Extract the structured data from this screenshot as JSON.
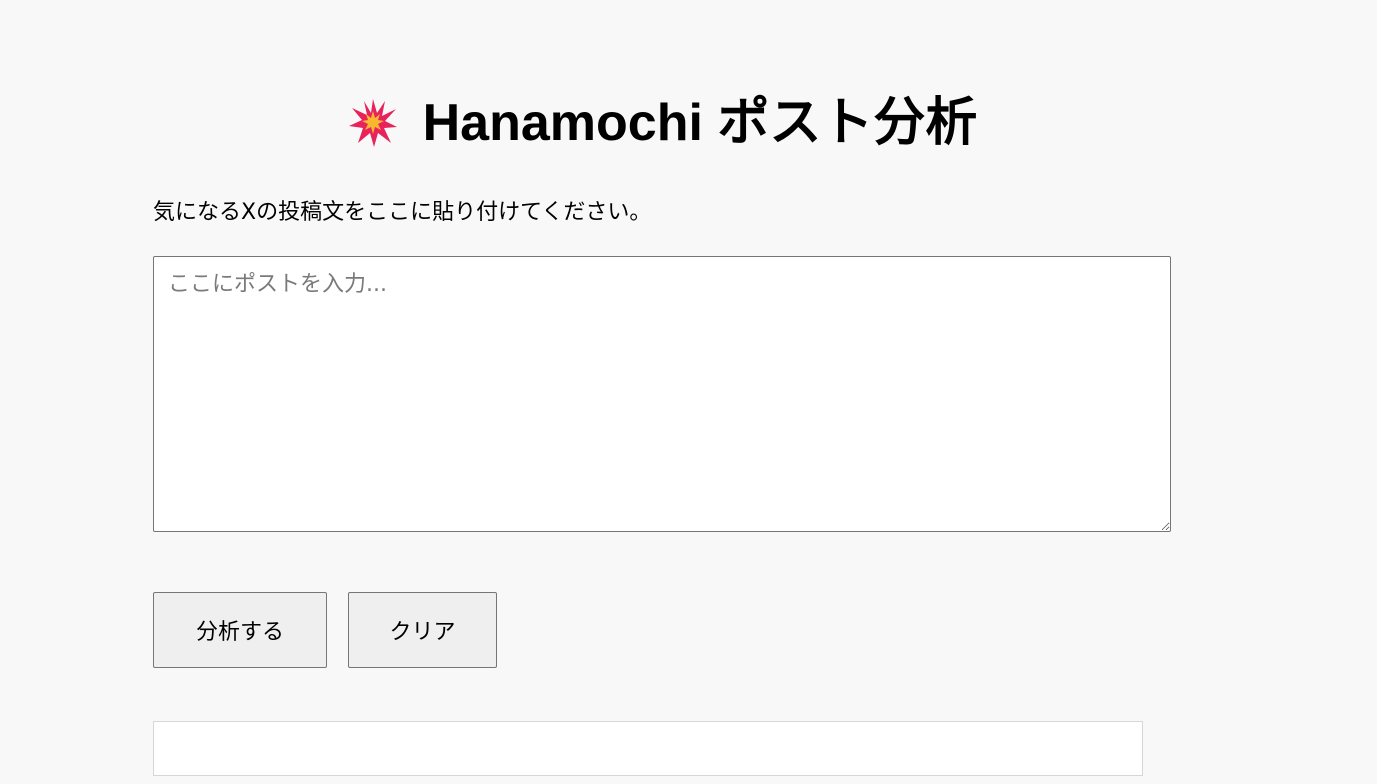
{
  "header": {
    "title": "Hanamochi ポスト分析",
    "icon": "collision-icon",
    "icon_colors": {
      "outer": "#e8225a",
      "inner": "#f7b731"
    }
  },
  "instructions": "気になるXの投稿文をここに貼り付けてください。",
  "post_input": {
    "placeholder": "ここにポストを入力...",
    "value": ""
  },
  "actions": {
    "analyze_label": "分析する",
    "clear_label": "クリア"
  },
  "result": {
    "text": ""
  }
}
